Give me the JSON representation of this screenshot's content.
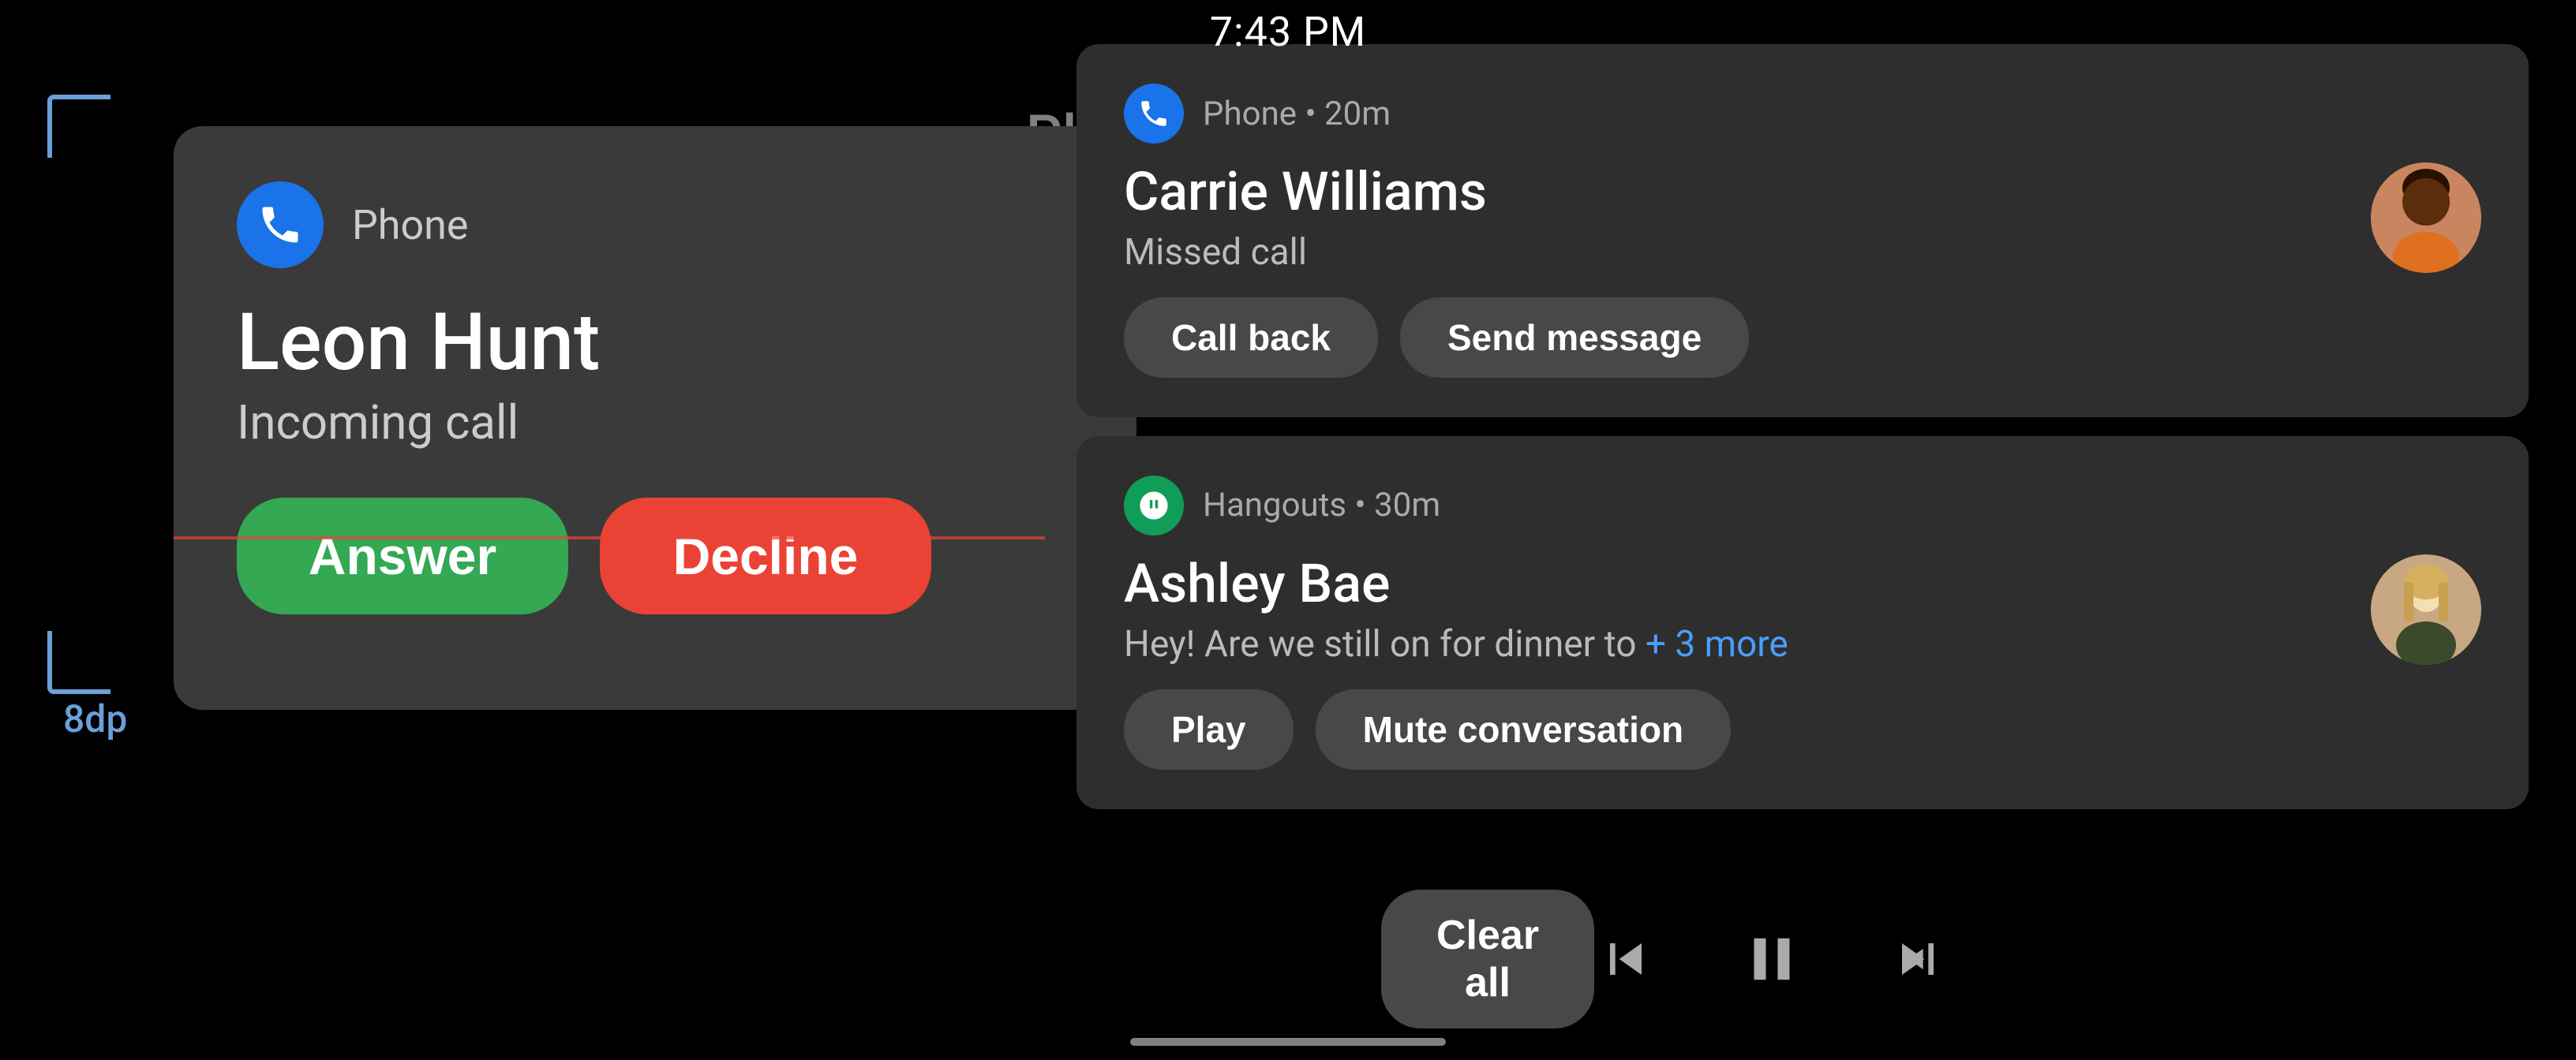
{
  "statusBar": {
    "time": "7:43 PM"
  },
  "bgText": "Playi",
  "label8dp": "8dp",
  "incomingCall": {
    "appName": "Phone",
    "callerName": "Leon Hunt",
    "callStatus": "Incoming call",
    "answerLabel": "Answer",
    "declineLabel": "Decline"
  },
  "notification1": {
    "appName": "Phone • 20m",
    "title": "Carrie Williams",
    "subtitle": "Missed call",
    "btn1": "Call back",
    "btn2": "Send message"
  },
  "notification2": {
    "appName": "Hangouts • 30m",
    "title": "Ashley Bae",
    "messagePreview": "Hey! Are we still on for dinner to",
    "moreBadge": "+ 3 more",
    "btn1": "Play",
    "btn2": "Mute conversation"
  },
  "bottomBar": {
    "clearAll": "Clear all"
  },
  "icons": {
    "phone": "phone-icon",
    "hangouts": "hangouts-icon",
    "prevTrack": "prev-track-icon",
    "pause": "pause-icon",
    "nextTrack": "next-track-icon"
  }
}
